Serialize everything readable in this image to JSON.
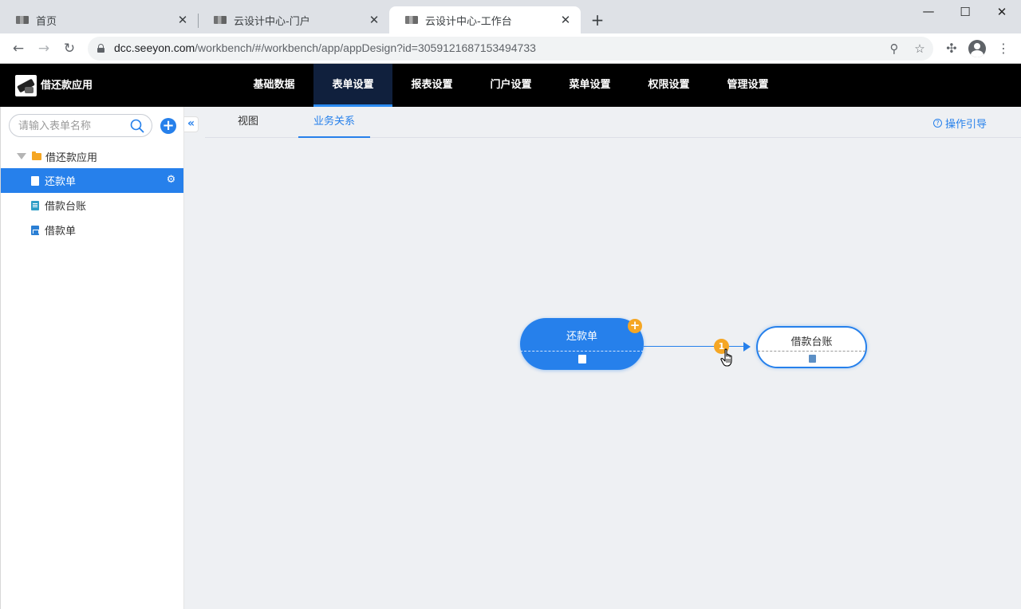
{
  "browser": {
    "tabs": [
      {
        "title": "首页"
      },
      {
        "title": "云设计中心-门户"
      },
      {
        "title": "云设计中心-工作台"
      }
    ],
    "url": {
      "host": "dcc.seeyon.com",
      "path": "/workbench/#/workbench/app/appDesign?id=3059121687153494733"
    }
  },
  "app": {
    "name": "借还款应用",
    "nav": [
      {
        "label": "基础数据"
      },
      {
        "label": "表单设置",
        "active": true
      },
      {
        "label": "报表设置"
      },
      {
        "label": "门户设置"
      },
      {
        "label": "菜单设置"
      },
      {
        "label": "权限设置"
      },
      {
        "label": "管理设置"
      }
    ]
  },
  "sidebar": {
    "search_placeholder": "请输入表单名称",
    "root_label": "借还款应用",
    "items": [
      {
        "label": "还款单",
        "selected": true
      },
      {
        "label": "借款台账"
      },
      {
        "label": "借款单"
      }
    ]
  },
  "main": {
    "tabs": [
      {
        "label": "视图"
      },
      {
        "label": "业务关系",
        "active": true
      }
    ],
    "guide_label": "操作引导"
  },
  "diagram": {
    "source_node": "还款单",
    "target_node": "借款台账",
    "relation_count": "1",
    "colors": {
      "primary": "#2680eb",
      "badge": "#f5a623"
    }
  }
}
